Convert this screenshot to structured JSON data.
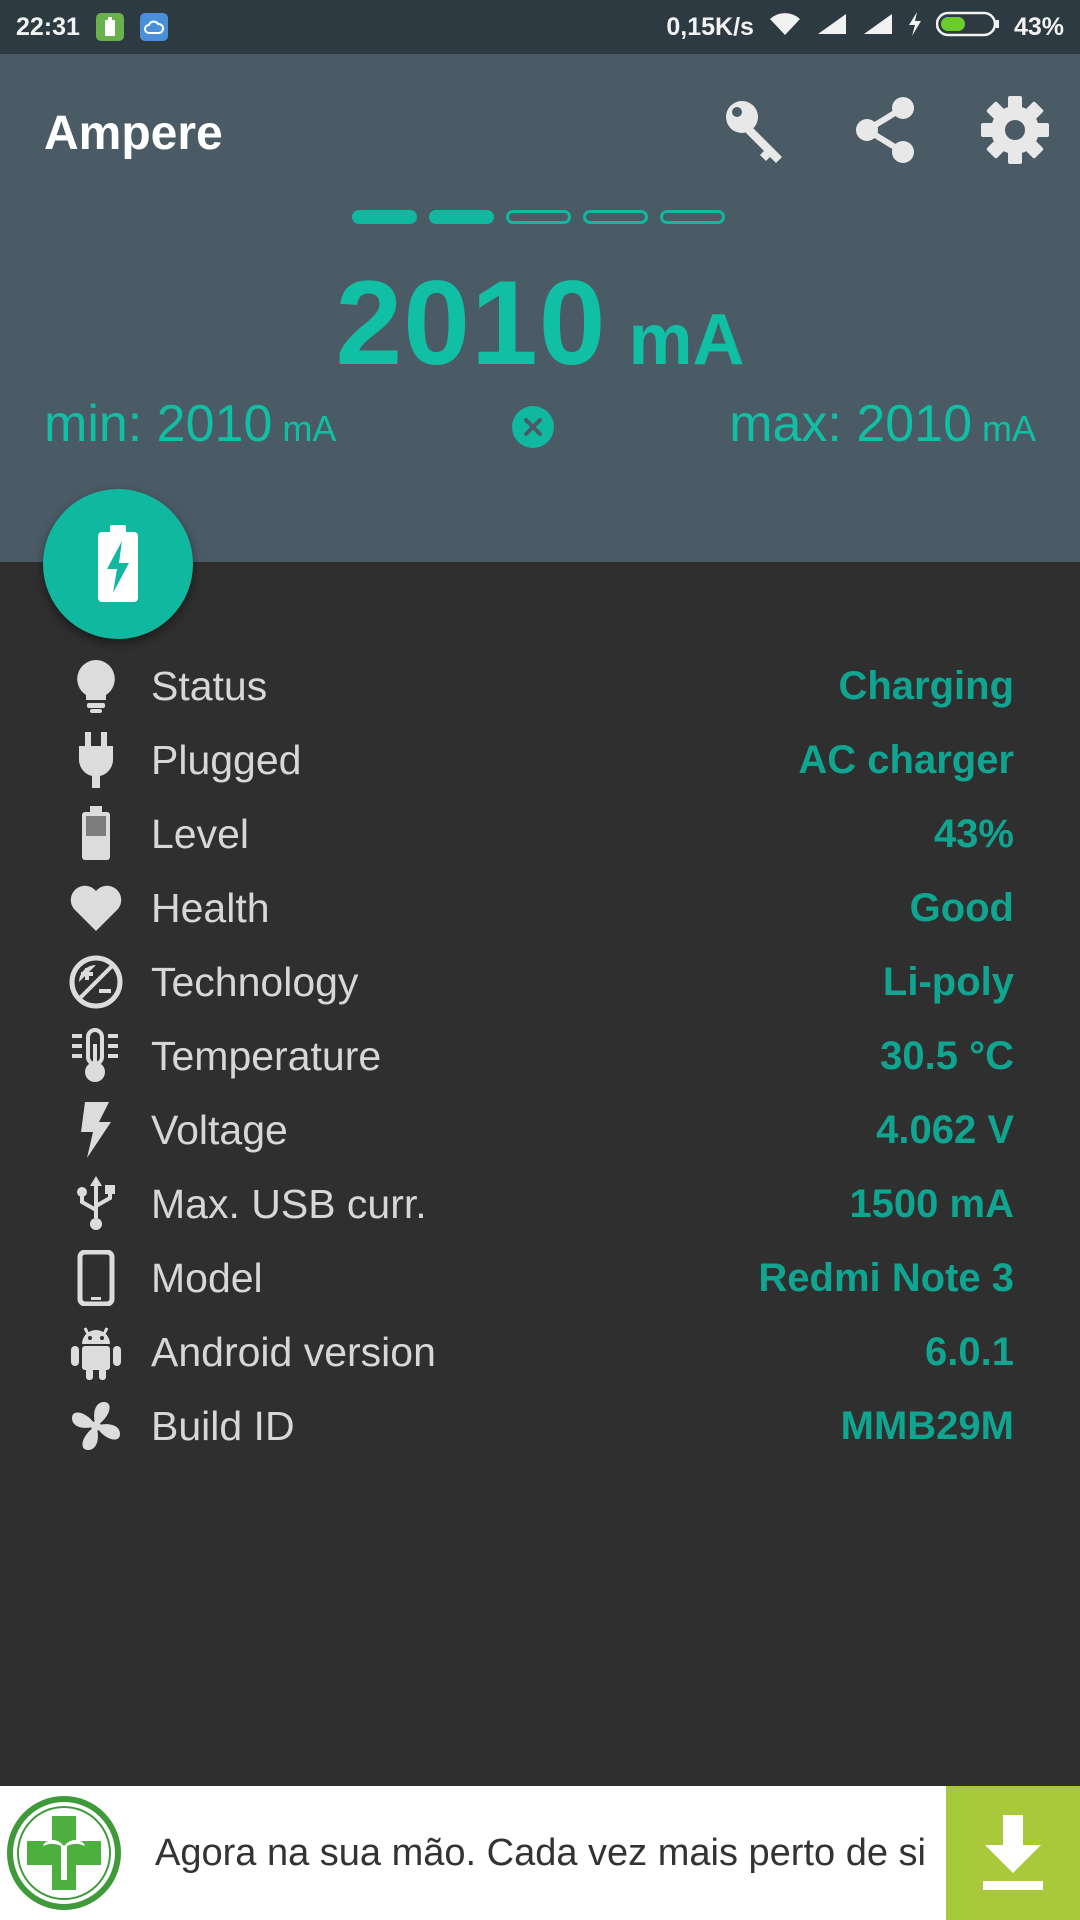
{
  "status_bar": {
    "time": "22:31",
    "net_speed": "0,15K/s",
    "battery_percent": "43%"
  },
  "toolbar": {
    "title": "Ampere",
    "icons": [
      "key-icon",
      "share-icon",
      "gear-icon"
    ]
  },
  "pager": {
    "total_pages": 5,
    "active_pages": 2
  },
  "current": {
    "value": "2010",
    "unit": "mA",
    "min_label": "min: 2010",
    "min_unit": "mA",
    "max_label": "max: 2010",
    "max_unit": "mA"
  },
  "info": [
    {
      "icon": "lightbulb-icon",
      "label": "Status",
      "value": "Charging"
    },
    {
      "icon": "plug-icon",
      "label": "Plugged",
      "value": "AC charger"
    },
    {
      "icon": "battery-icon",
      "label": "Level",
      "value": "43%"
    },
    {
      "icon": "heart-icon",
      "label": "Health",
      "value": "Good"
    },
    {
      "icon": "plus-minus-icon",
      "label": "Technology",
      "value": "Li-poly"
    },
    {
      "icon": "thermometer-icon",
      "label": "Temperature",
      "value": "30.5 °C"
    },
    {
      "icon": "lightning-icon",
      "label": "Voltage",
      "value": "4.062 V"
    },
    {
      "icon": "usb-icon",
      "label": "Max. USB curr.",
      "value": "1500 mA"
    },
    {
      "icon": "phone-icon",
      "label": "Model",
      "value": "Redmi Note 3"
    },
    {
      "icon": "android-icon",
      "label": "Android version",
      "value": "6.0.1"
    },
    {
      "icon": "fan-icon",
      "label": "Build ID",
      "value": "MMB29M"
    }
  ],
  "ad": {
    "text": "Agora na sua mão. Cada vez mais perto de si"
  },
  "colors": {
    "accent": "#10b8a0",
    "header_bg": "#4b5b66",
    "body_bg": "#2f2f2f",
    "ad_button": "#a8c93a"
  }
}
